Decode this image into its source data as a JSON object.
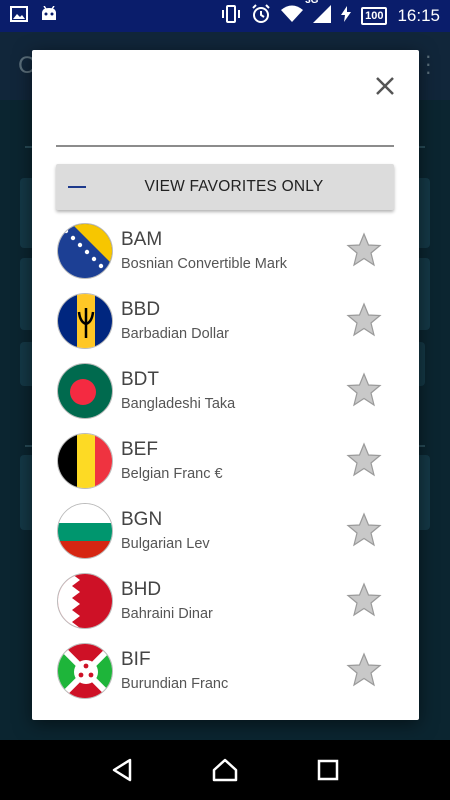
{
  "status_bar": {
    "network": "3G",
    "battery": "100",
    "time": "16:15"
  },
  "dialog": {
    "fav_toggle_label": "VIEW FAVORITES ONLY",
    "currencies": [
      {
        "code": "BAM",
        "name": "Bosnian Convertible Mark",
        "favorite": false
      },
      {
        "code": "BBD",
        "name": "Barbadian Dollar",
        "favorite": false
      },
      {
        "code": "BDT",
        "name": "Bangladeshi Taka",
        "favorite": false
      },
      {
        "code": "BEF",
        "name": "Belgian Franc €",
        "favorite": false
      },
      {
        "code": "BGN",
        "name": "Bulgarian Lev",
        "favorite": false
      },
      {
        "code": "BHD",
        "name": "Bahraini Dinar",
        "favorite": false
      },
      {
        "code": "BIF",
        "name": "Burundian Franc",
        "favorite": false
      }
    ]
  }
}
